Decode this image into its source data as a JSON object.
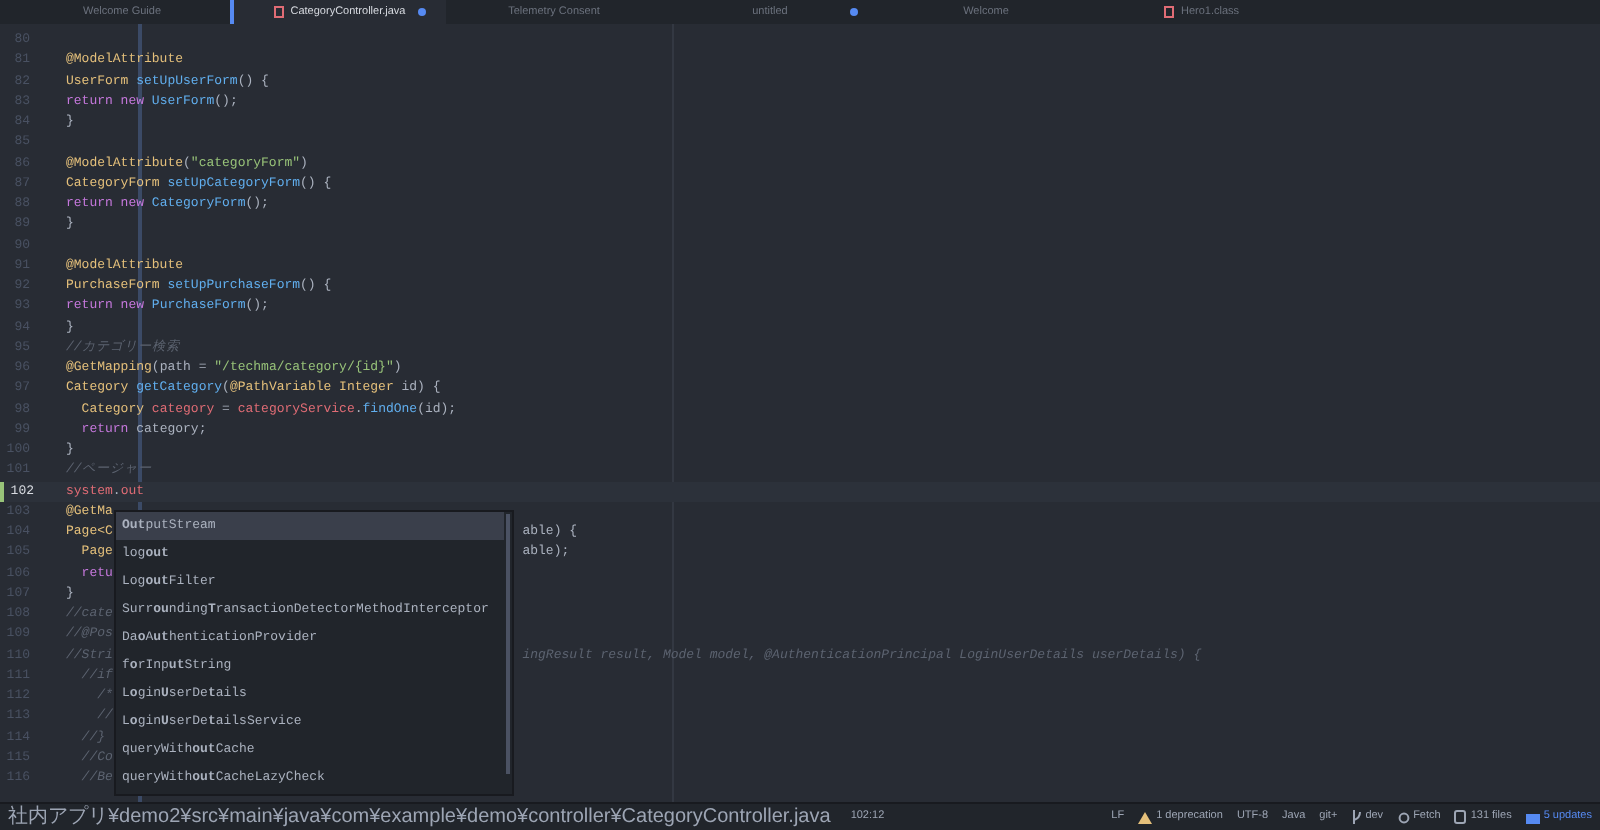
{
  "tabs": [
    {
      "label": "Welcome Guide",
      "selected": false,
      "kind": "plain",
      "modified": false
    },
    {
      "label": "CategoryController.java",
      "selected": true,
      "kind": "file",
      "modified": true
    },
    {
      "label": "Telemetry Consent",
      "selected": false,
      "kind": "plain",
      "modified": false
    },
    {
      "label": "untitled",
      "selected": false,
      "kind": "plain",
      "modified": true
    },
    {
      "label": "Welcome",
      "selected": false,
      "kind": "plain",
      "modified": false
    },
    {
      "label": "Hero1.class",
      "selected": false,
      "kind": "file",
      "modified": false
    }
  ],
  "editor": {
    "lines": [
      {
        "n": "80",
        "current": false
      },
      {
        "n": "81",
        "current": false,
        "code": [
          {
            "text": "@ModelAttribute",
            "kind": "ann"
          }
        ]
      },
      {
        "n": "82",
        "current": false,
        "code": [
          {
            "text": "UserForm ",
            "kind": "type"
          },
          {
            "text": "setUpUserForm",
            "kind": "fn"
          },
          {
            "text": "() {",
            "kind": "plain"
          }
        ]
      },
      {
        "n": "83",
        "current": false,
        "code": [
          {
            "text": "return new ",
            "kind": "kw"
          },
          {
            "text": "UserForm",
            "kind": "fn"
          },
          {
            "text": "();",
            "kind": "plain"
          }
        ]
      },
      {
        "n": "84",
        "current": false,
        "code": [
          {
            "text": "}",
            "kind": "plain"
          }
        ]
      },
      {
        "n": "85",
        "current": false
      },
      {
        "n": "86",
        "current": false,
        "code": [
          {
            "text": "@ModelAttribute",
            "kind": "ann"
          },
          {
            "text": "(",
            "kind": "plain"
          },
          {
            "text": "\"categoryForm\"",
            "kind": "str"
          },
          {
            "text": ")",
            "kind": "plain"
          }
        ]
      },
      {
        "n": "87",
        "current": false,
        "code": [
          {
            "text": "CategoryForm ",
            "kind": "type"
          },
          {
            "text": "setUpCategoryForm",
            "kind": "fn"
          },
          {
            "text": "() {",
            "kind": "plain"
          }
        ]
      },
      {
        "n": "88",
        "current": false,
        "code": [
          {
            "text": "return new ",
            "kind": "kw"
          },
          {
            "text": "CategoryForm",
            "kind": "fn"
          },
          {
            "text": "();",
            "kind": "plain"
          }
        ]
      },
      {
        "n": "89",
        "current": false,
        "code": [
          {
            "text": "}",
            "kind": "plain"
          }
        ]
      },
      {
        "n": "90",
        "current": false
      },
      {
        "n": "91",
        "current": false,
        "code": [
          {
            "text": "@ModelAttribute",
            "kind": "ann"
          }
        ]
      },
      {
        "n": "92",
        "current": false,
        "code": [
          {
            "text": "PurchaseForm ",
            "kind": "type"
          },
          {
            "text": "setUpPurchaseForm",
            "kind": "fn"
          },
          {
            "text": "() {",
            "kind": "plain"
          }
        ]
      },
      {
        "n": "93",
        "current": false,
        "code": [
          {
            "text": "return new ",
            "kind": "kw"
          },
          {
            "text": "PurchaseForm",
            "kind": "fn"
          },
          {
            "text": "();",
            "kind": "plain"
          }
        ]
      },
      {
        "n": "94",
        "current": false,
        "code": [
          {
            "text": "}",
            "kind": "plain"
          }
        ]
      },
      {
        "n": "95",
        "current": false,
        "code": [
          {
            "text": "//カテゴリー検索",
            "kind": "comment"
          }
        ]
      },
      {
        "n": "96",
        "current": false,
        "code": [
          {
            "text": "@GetMapping",
            "kind": "ann"
          },
          {
            "text": "(path = ",
            "kind": "plain"
          },
          {
            "text": "\"/techma/category/{id}\"",
            "kind": "str"
          },
          {
            "text": ")",
            "kind": "plain"
          }
        ]
      },
      {
        "n": "97",
        "current": false,
        "code": [
          {
            "text": "Category ",
            "kind": "type"
          },
          {
            "text": "getCategory",
            "kind": "fn"
          },
          {
            "text": "(",
            "kind": "plain"
          },
          {
            "text": "@PathVariable ",
            "kind": "ann"
          },
          {
            "text": "Integer",
            "kind": "type"
          },
          {
            "text": " id) {",
            "kind": "plain"
          }
        ]
      },
      {
        "n": "98",
        "current": false,
        "code": [
          {
            "text": "  Category ",
            "kind": "type"
          },
          {
            "text": "category",
            "kind": "var"
          },
          {
            "text": " = ",
            "kind": "plain"
          },
          {
            "text": "categoryService",
            "kind": "var"
          },
          {
            "text": ".",
            "kind": "plain"
          },
          {
            "text": "findOne",
            "kind": "fn"
          },
          {
            "text": "(id);",
            "kind": "plain"
          }
        ]
      },
      {
        "n": "99",
        "current": false,
        "code": [
          {
            "text": "  return",
            "kind": "kw"
          },
          {
            "text": " category;",
            "kind": "plain"
          }
        ]
      },
      {
        "n": "100",
        "current": false,
        "code": [
          {
            "text": "}",
            "kind": "plain"
          }
        ]
      },
      {
        "n": "101",
        "current": false,
        "code": [
          {
            "text": "//ページャー",
            "kind": "comment"
          }
        ]
      },
      {
        "n": "102",
        "current": true,
        "code": [
          {
            "text": "system",
            "kind": "var"
          },
          {
            "text": ".",
            "kind": "plain"
          },
          {
            "text": "out",
            "kind": "var"
          }
        ]
      },
      {
        "n": "103",
        "current": false,
        "code": [
          {
            "text": "@GetMa",
            "kind": "ann"
          }
        ]
      },
      {
        "n": "104",
        "current": false,
        "code": [
          {
            "text": "Page<C",
            "kind": "type"
          }
        ],
        "tail": [
          {
            "text": "able) {",
            "kind": "plain"
          }
        ]
      },
      {
        "n": "105",
        "current": false,
        "code": [
          {
            "text": "  Page",
            "kind": "type"
          }
        ],
        "tail": [
          {
            "text": "able);",
            "kind": "plain"
          }
        ]
      },
      {
        "n": "106",
        "current": false,
        "code": [
          {
            "text": "  retu",
            "kind": "kw"
          }
        ]
      },
      {
        "n": "107",
        "current": false,
        "code": [
          {
            "text": "}",
            "kind": "plain"
          }
        ]
      },
      {
        "n": "108",
        "current": false,
        "code": [
          {
            "text": "//cate",
            "kind": "comment"
          }
        ]
      },
      {
        "n": "109",
        "current": false,
        "code": [
          {
            "text": "//@Pos",
            "kind": "comment"
          }
        ]
      },
      {
        "n": "110",
        "current": false,
        "code": [
          {
            "text": "//Stri",
            "kind": "comment"
          }
        ],
        "tail": [
          {
            "text": "ingResult result, Model model, @AuthenticationPrincipal LoginUserDetails userDetails) {",
            "kind": "comment"
          }
        ]
      },
      {
        "n": "111",
        "current": false,
        "code": [
          {
            "text": "  //if",
            "kind": "comment"
          }
        ]
      },
      {
        "n": "112",
        "current": false,
        "code": [
          {
            "text": "    /*",
            "kind": "comment"
          }
        ]
      },
      {
        "n": "113",
        "current": false,
        "code": [
          {
            "text": "    //",
            "kind": "comment"
          }
        ]
      },
      {
        "n": "114",
        "current": false,
        "code": [
          {
            "text": "  //}",
            "kind": "comment"
          }
        ]
      },
      {
        "n": "115",
        "current": false,
        "code": [
          {
            "text": "  //Co",
            "kind": "comment"
          }
        ]
      },
      {
        "n": "116",
        "current": false,
        "code": [
          {
            "text": "  //Be",
            "kind": "comment"
          }
        ]
      }
    ]
  },
  "autocomplete": [
    {
      "label": "**Out**putStream",
      "selected": true
    },
    {
      "label": "log**out**",
      "selected": false
    },
    {
      "label": "Log**out**Filter",
      "selected": false
    },
    {
      "label": "Surr**ou**nding**T**ransactionDetectorMethodInterceptor",
      "selected": false
    },
    {
      "label": "Da**o**A**ut**henticationProvider",
      "selected": false
    },
    {
      "label": "f**o**rInp**ut**String",
      "selected": false
    },
    {
      "label": "L**o**gin**U**serDe**t**ails",
      "selected": false
    },
    {
      "label": "L**o**gin**U**serDe**t**ailsService",
      "selected": false
    },
    {
      "label": "queryWith**out**Cache",
      "selected": false
    },
    {
      "label": "queryWith**out**CacheLazyCheck",
      "selected": false
    }
  ],
  "status_bar": {
    "path": "社内アプリ¥demo2¥src¥main¥java¥com¥example¥demo¥controller¥CategoryController.java",
    "cursor": "102:12",
    "items": [
      {
        "kind": "text",
        "label": "LF"
      },
      {
        "kind": "warning",
        "label": "1 deprecation"
      },
      {
        "kind": "text",
        "label": "UTF-8"
      },
      {
        "kind": "text",
        "label": "Java"
      },
      {
        "kind": "text",
        "label": "git+"
      },
      {
        "kind": "branch",
        "label": "dev"
      },
      {
        "kind": "fetch",
        "label": "Fetch"
      },
      {
        "kind": "files",
        "label": "131 files"
      },
      {
        "kind": "updates",
        "label": "5 updates"
      }
    ]
  }
}
